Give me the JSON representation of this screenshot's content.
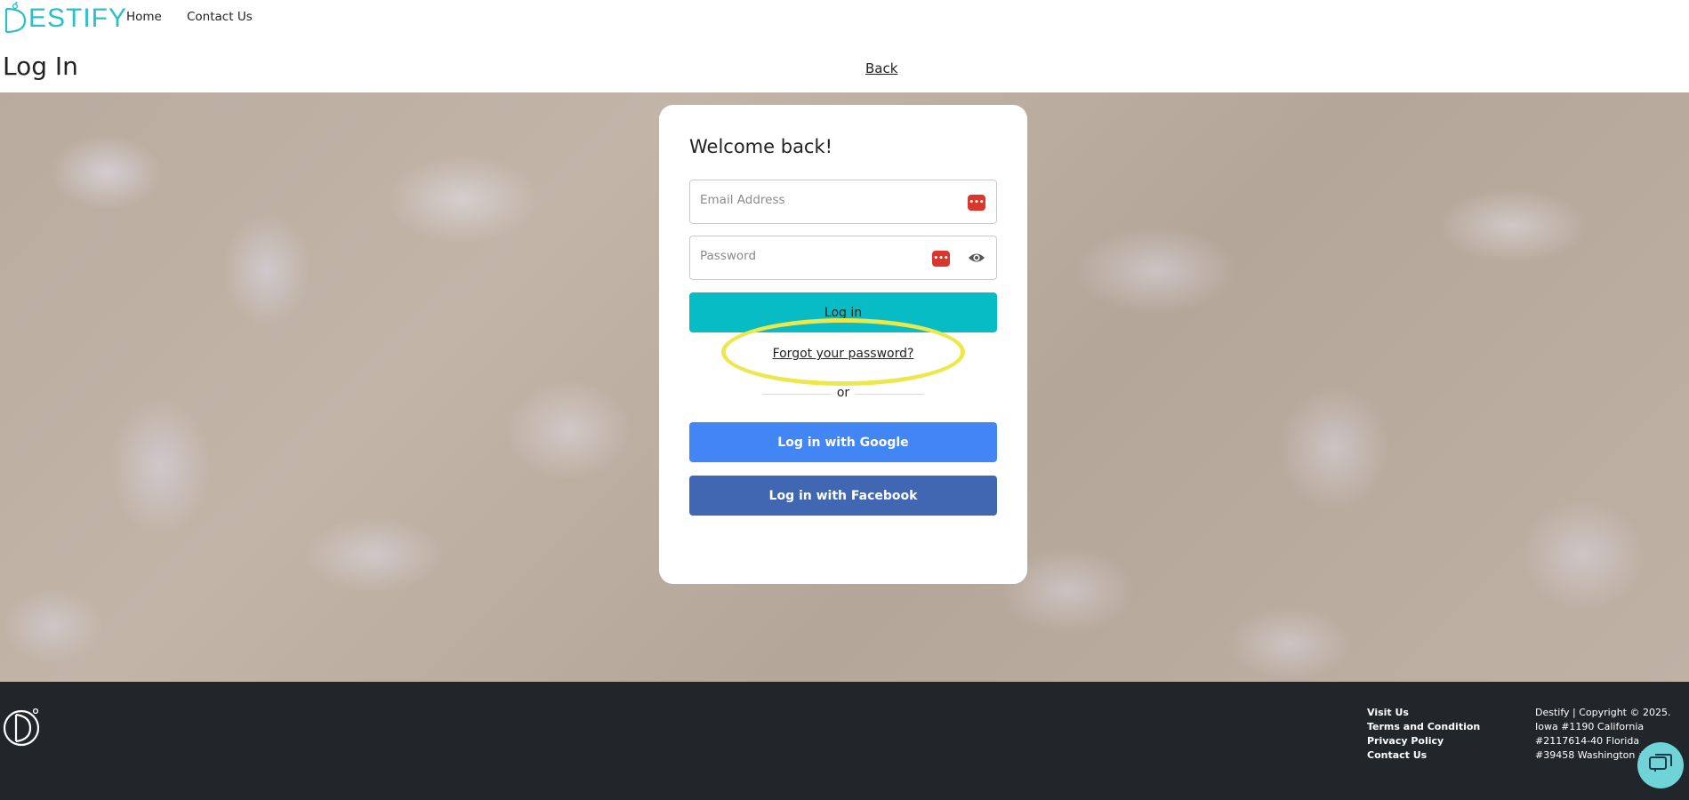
{
  "nav": {
    "logo_text": "ESTIFY",
    "links": [
      "Home",
      "Contact Us"
    ]
  },
  "titlebar": {
    "title": "Log In",
    "back_label": "Back"
  },
  "login": {
    "heading": "Welcome back!",
    "email_placeholder": "Email Address",
    "password_placeholder": "Password",
    "login_label": "Log in",
    "forgot_label": "Forgot your password?",
    "or_label": "or",
    "google_label": "Log in with Google",
    "facebook_label": "Log in with Facebook"
  },
  "footer": {
    "links": [
      "Visit Us",
      "Terms and Condition",
      "Privacy Policy",
      "Contact Us"
    ],
    "copyright_lines": [
      "Destify | Copyright © 2025.",
      "Iowa #1190 California",
      "#2117614-40 Florida",
      "#39458 Washington #6"
    ]
  },
  "colors": {
    "accent": "#08bcc6",
    "google": "#4285f4",
    "facebook": "#4267b2",
    "highlight": "#ece74a",
    "footer_bg": "#21262b"
  },
  "icons": [
    "password-manager-icon",
    "eye-icon",
    "chat-icon",
    "logo-icon"
  ]
}
